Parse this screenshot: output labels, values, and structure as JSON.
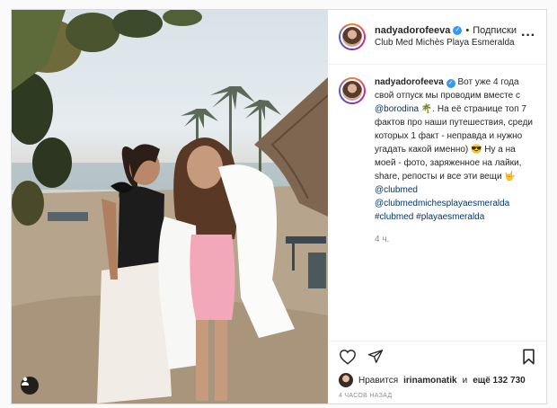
{
  "post": {
    "username": "nadyadorofeeva",
    "verified_mark": "✓",
    "dot": "•",
    "follow_label": "Подписки",
    "location": "Club Med Michès Playa Esmeralda",
    "more_label": "···"
  },
  "caption": {
    "username": "nadyadorofeeva",
    "part1": " Вот уже 4 года свой отпуск мы проводим вместе с ",
    "mention1": "@borodina",
    "part2": " 🌴. На её странице топ 7 фактов про наши путешествия, среди которых 1 факт - неправда и нужно угадать какой именно) 😎 Ну а на моей - фото, заряженное на лайки, share, репосты и все эти вещи 🤟 ",
    "mention2": "@clubmed",
    "mention3": "@clubmedmichesplayaesmeralda",
    "hashtag1": "#clubmed",
    "hashtag2": "#playaesmeralda",
    "time": "4 ч."
  },
  "icons": {
    "heart": "heart-icon",
    "comment": "comment-icon",
    "share": "share-icon",
    "save": "bookmark-icon",
    "user_tag": "user-tag-icon"
  },
  "likes": {
    "prefix": "Нравится",
    "user": "irinamonatik",
    "middle": "и",
    "others": "ещё 132 730"
  },
  "ago": "4 ЧАСОВ НАЗАД",
  "colors": {
    "link": "#00376b",
    "verified": "#3897f0",
    "muted": "#8e8e8e"
  }
}
